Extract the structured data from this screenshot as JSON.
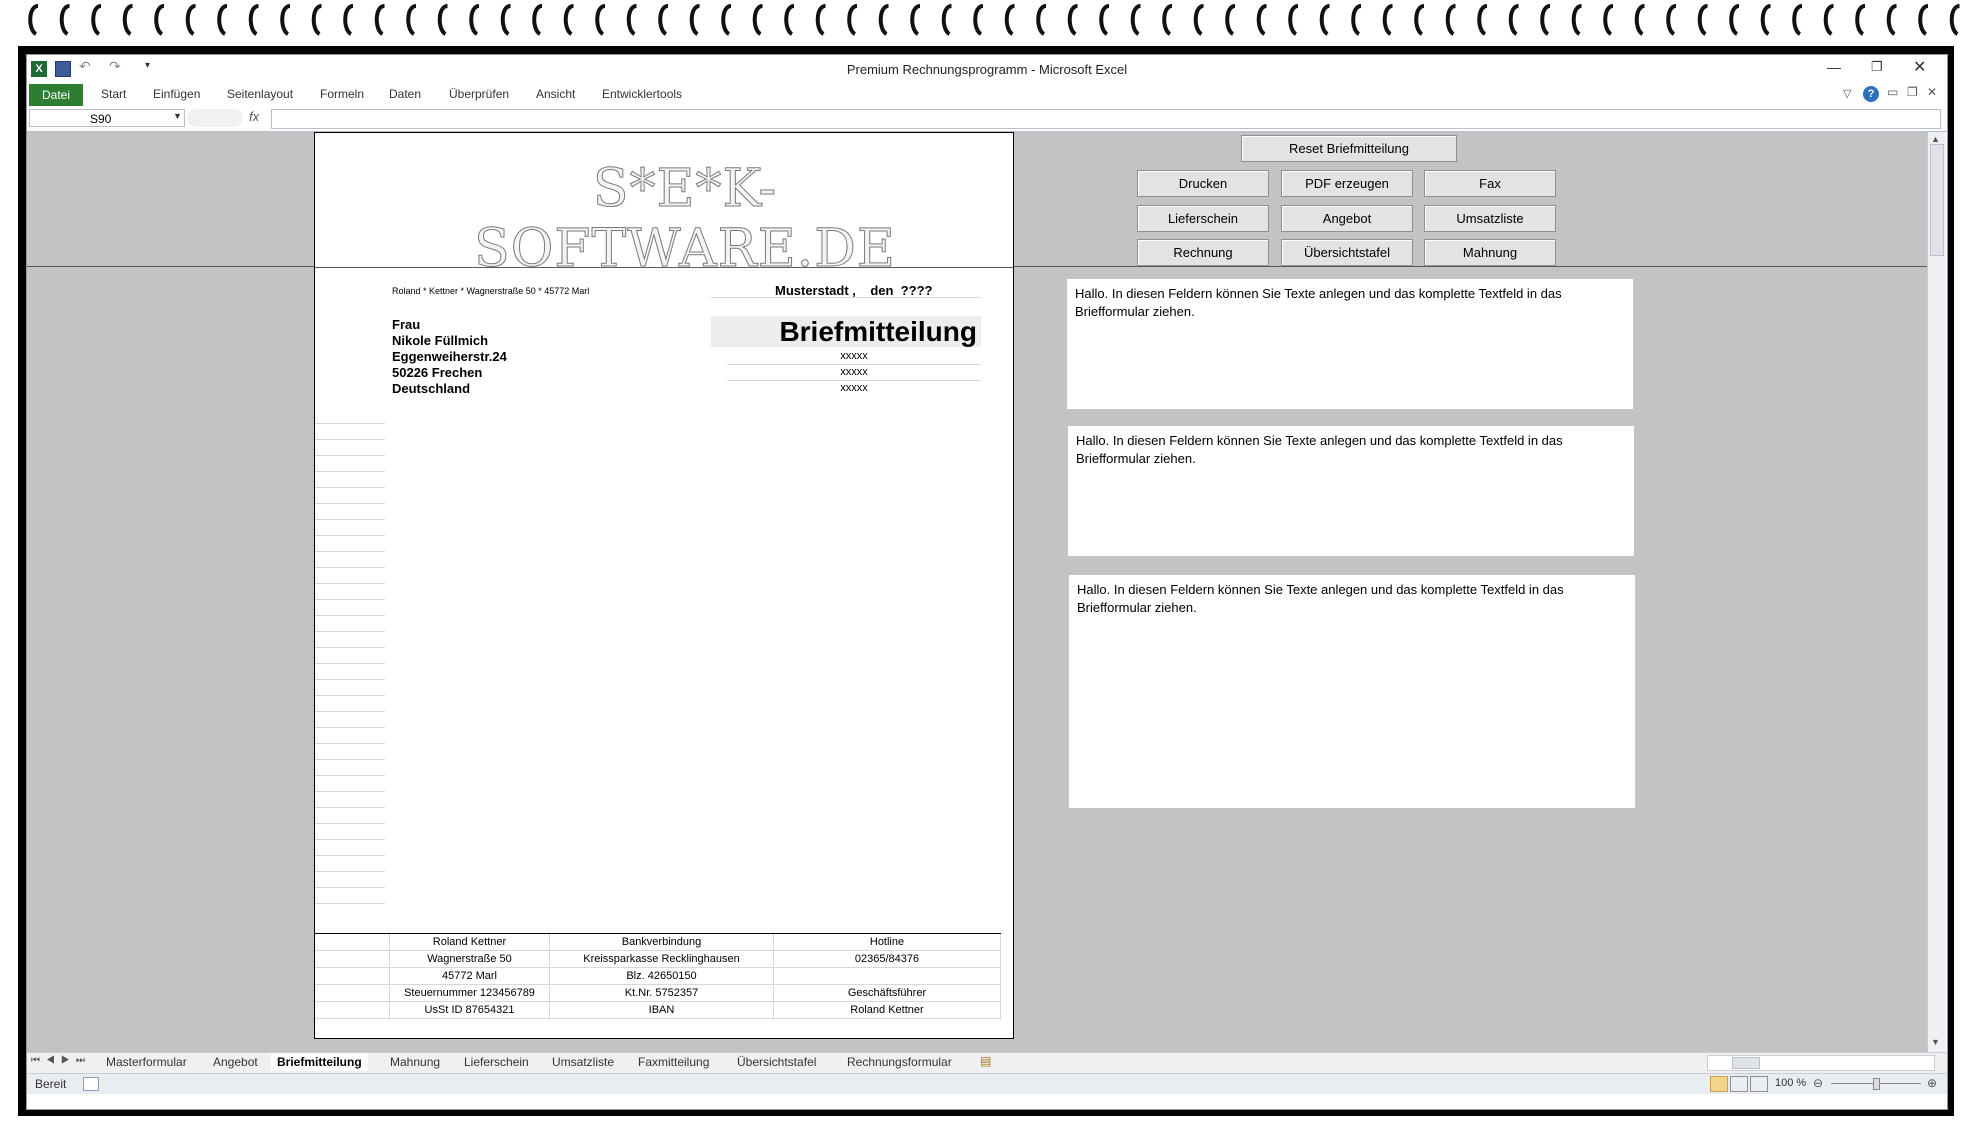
{
  "window": {
    "title": "Premium Rechnungsprogramm  -  Microsoft Excel"
  },
  "ribbon": {
    "tabs": [
      "Datei",
      "Start",
      "Einfügen",
      "Seitenlayout",
      "Formeln",
      "Daten",
      "Überprüfen",
      "Ansicht",
      "Entwicklertools"
    ]
  },
  "formula_bar": {
    "name_box": "S90",
    "fx": "fx",
    "value": ""
  },
  "document": {
    "logo": "S*E*K-SOFTWARE.DE",
    "sender_line": "Roland * Kettner * Wagnerstraße 50 * 45772 Marl",
    "place_date": "Musterstadt ,    den  ????",
    "recipient": [
      "Frau",
      "Nikole Füllmich",
      "Eggenweiherstr.24",
      "50226 Frechen",
      "Deutschland"
    ],
    "doc_title": "Briefmitteilung",
    "refs": [
      "xxxxx",
      "xxxxx",
      "xxxxx"
    ],
    "footer": [
      [
        "Roland Kettner",
        "Bankverbindung",
        "Hotline"
      ],
      [
        "Wagnerstraße 50",
        "Kreissparkasse Recklinghausen",
        "02365/84376"
      ],
      [
        "45772 Marl",
        "Blz. 42650150",
        ""
      ],
      [
        "Steuernummer 123456789",
        "Kt.Nr. 5752357",
        "Geschäftsführer"
      ],
      [
        "UsSt ID 87654321",
        "IBAN",
        "Roland Kettner"
      ]
    ]
  },
  "buttons": {
    "reset": "Reset Briefmitteilung",
    "drucken": "Drucken",
    "pdf": "PDF erzeugen",
    "fax": "Fax",
    "lieferschein": "Lieferschein",
    "angebot": "Angebot",
    "umsatzliste": "Umsatzliste",
    "rechnung": "Rechnung",
    "uebersichtstafel": "Übersichtstafel",
    "mahnung": "Mahnung"
  },
  "notes": [
    "Hallo. In diesen Feldern können Sie Texte anlegen und das komplette Textfeld in das Briefformular ziehen.",
    "Hallo. In diesen Feldern können Sie Texte anlegen und das komplette Textfeld in das Briefformular ziehen.",
    "Hallo. In diesen Feldern können Sie Texte anlegen und das komplette Textfeld in das Briefformular ziehen."
  ],
  "sheet_tabs": [
    "Masterformular",
    "Angebot",
    "Briefmitteilung",
    "Mahnung",
    "Lieferschein",
    "Umsatzliste",
    "Faxmitteilung",
    "Übersichtstafel",
    "Rechnungsformular"
  ],
  "active_sheet": "Briefmitteilung",
  "status": {
    "ready": "Bereit",
    "zoom": "100 %"
  }
}
